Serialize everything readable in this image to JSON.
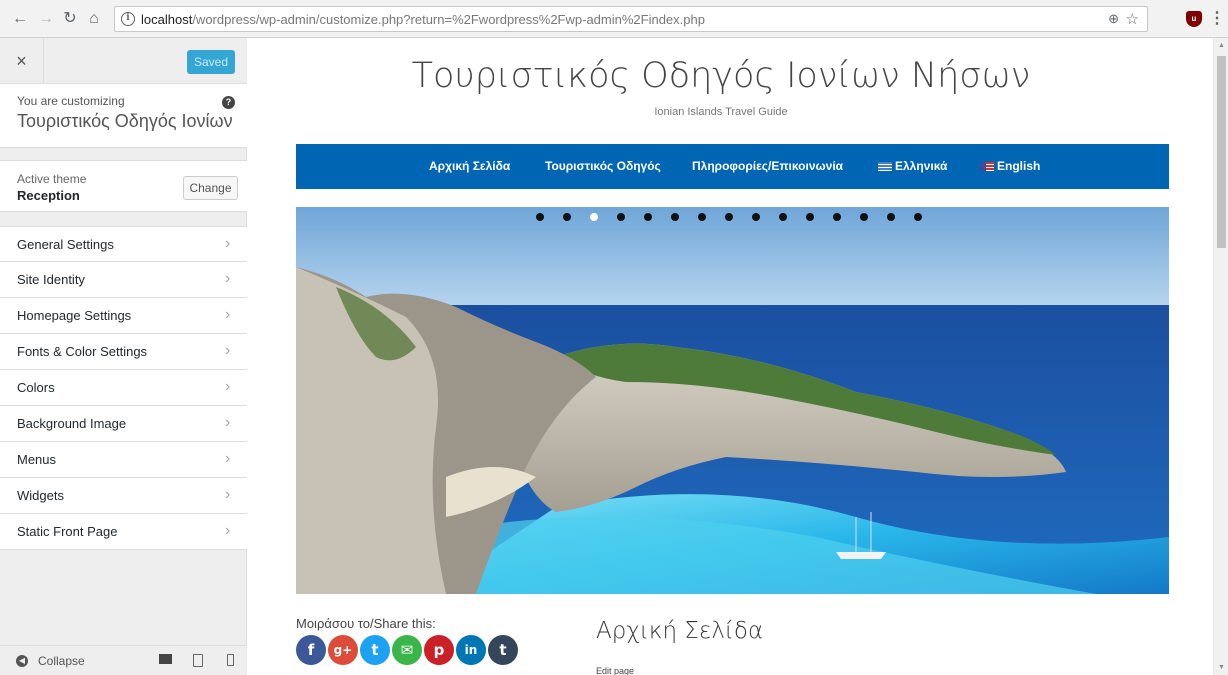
{
  "browser": {
    "url_host": "localhost",
    "url_path": "/wordpress/wp-admin/customize.php?return=%2Fwordpress%2Fwp-admin%2Findex.php"
  },
  "sidebar": {
    "close_glyph": "×",
    "saved_label": "Saved",
    "customizing_label": "You are customizing",
    "site_name": "Τουριστικός Οδηγός Ιονίων ...",
    "active_theme_label": "Active theme",
    "theme_name": "Reception",
    "change_label": "Change",
    "sections": [
      {
        "label": "General Settings"
      },
      {
        "label": "Site Identity"
      },
      {
        "label": "Homepage Settings"
      },
      {
        "label": "Fonts & Color Settings"
      },
      {
        "label": "Colors"
      },
      {
        "label": "Background Image"
      },
      {
        "label": "Menus"
      },
      {
        "label": "Widgets"
      },
      {
        "label": "Static Front Page"
      }
    ],
    "collapse_label": "Collapse"
  },
  "preview": {
    "site_title": "Τουριστικός Οδηγός Ιονίων Νήσων",
    "tagline": "Ionian Islands Travel Guide",
    "nav": [
      {
        "label": "Αρχική Σελίδα"
      },
      {
        "label": "Τουριστικός Οδηγός"
      },
      {
        "label": "Πληροφορίες/Επικοινωνία"
      },
      {
        "label": "Ελληνικά",
        "flag": "greek-flag-icon"
      },
      {
        "label": "English",
        "flag": "us-flag-icon"
      }
    ],
    "slider_dots": 15,
    "active_dot_index": 2,
    "share_label": "Μοιράσου το/Share this:",
    "share_icons": [
      {
        "name": "facebook-icon",
        "glyph": "f",
        "color": "#3b5998"
      },
      {
        "name": "google-plus-icon",
        "glyph": "g+",
        "color": "#dd4b39"
      },
      {
        "name": "twitter-icon",
        "glyph": "t",
        "color": "#1da1f2"
      },
      {
        "name": "email-icon",
        "glyph": "✉",
        "color": "#3bb44a"
      },
      {
        "name": "pinterest-icon",
        "glyph": "p",
        "color": "#cb2027"
      },
      {
        "name": "linkedin-icon",
        "glyph": "in",
        "color": "#0077b5"
      },
      {
        "name": "tumblr-icon",
        "glyph": "t",
        "color": "#35465c"
      }
    ],
    "page_heading": "Αρχική Σελίδα",
    "edit_link": "Edit page"
  }
}
